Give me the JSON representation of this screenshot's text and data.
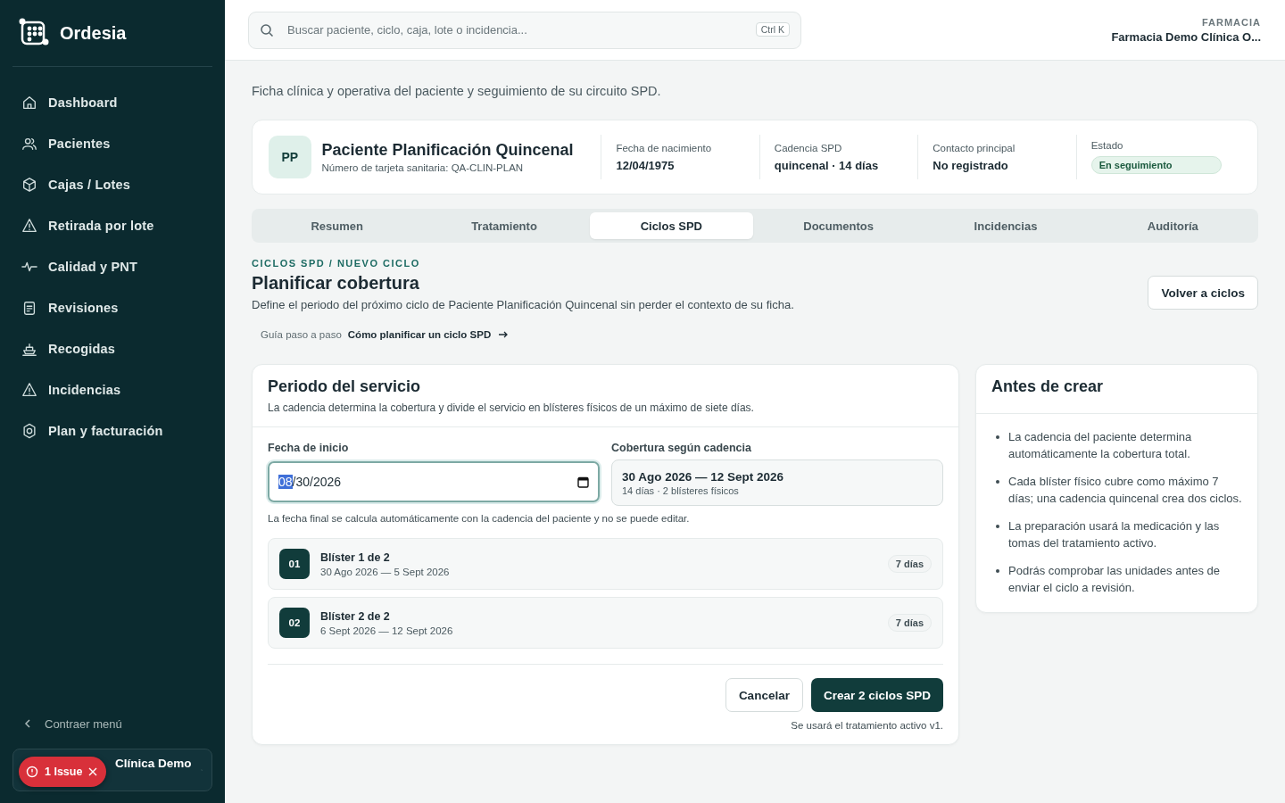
{
  "sidebar": {
    "brand": "Ordesia",
    "items": [
      {
        "label": "Dashboard"
      },
      {
        "label": "Pacientes"
      },
      {
        "label": "Cajas / Lotes"
      },
      {
        "label": "Retirada por lote"
      },
      {
        "label": "Calidad y PNT"
      },
      {
        "label": "Revisiones"
      },
      {
        "label": "Recogidas"
      },
      {
        "label": "Incidencias"
      },
      {
        "label": "Plan y facturación"
      }
    ],
    "collapse": "Contraer menú",
    "account": "Clínica Demo",
    "issue_badge": "1 Issue"
  },
  "header": {
    "search": {
      "placeholder": "Buscar paciente, ciclo, caja, lote o incidencia...",
      "shortcut": "Ctrl K"
    },
    "org_label": "FARMACIA",
    "org_name": "Farmacia Demo Clínica O..."
  },
  "page": {
    "subtitle": "Ficha clínica y operativa del paciente y seguimiento de su circuito SPD."
  },
  "patient": {
    "initials": "PP",
    "name": "Paciente Planificación Quincenal",
    "card": "Número de tarjeta sanitaria: QA-CLIN-PLAN",
    "facts": [
      {
        "label": "Fecha de nacimiento",
        "value": "12/04/1975"
      },
      {
        "label": "Cadencia SPD",
        "value": "quincenal · 14 días"
      },
      {
        "label": "Contacto principal",
        "value": "No registrado"
      }
    ],
    "status_label": "Estado",
    "status": "En seguimiento"
  },
  "tabs": [
    {
      "label": "Resumen",
      "selected": false
    },
    {
      "label": "Tratamiento",
      "selected": false
    },
    {
      "label": "Ciclos SPD",
      "selected": true
    },
    {
      "label": "Documentos",
      "selected": false
    },
    {
      "label": "Incidencias",
      "selected": false
    },
    {
      "label": "Auditoría",
      "selected": false
    }
  ],
  "section": {
    "breadcrumb": "CICLOS SPD / NUEVO CICLO",
    "title": "Planificar cobertura",
    "description": "Define el periodo del próximo ciclo de Paciente Planificación Quincenal sin perder el contexto de su ficha.",
    "back_button": "Volver a ciclos",
    "guide_label": "Guía paso a paso",
    "guide_link": "Cómo planificar un ciclo SPD"
  },
  "period_card": {
    "title": "Periodo del servicio",
    "description": "La cadencia determina la cobertura y divide el servicio en blísteres físicos de un máximo de siete días.",
    "start_label": "Fecha de inicio",
    "start_value_parts": [
      "08",
      "/30/2026"
    ],
    "coverage_label": "Cobertura según cadencia",
    "coverage_range": "30 Ago 2026 — 12 Sept 2026",
    "coverage_detail": "14 días · 2 blísteres físicos",
    "hint": "La fecha final se calcula automáticamente con la cadencia del paciente y no se puede editar.",
    "blisters": [
      {
        "number": "01",
        "title": "Blíster 1 de 2",
        "range": "30 Ago 2026 — 5 Sept 2026",
        "days": "7 días"
      },
      {
        "number": "02",
        "title": "Blíster 2 de 2",
        "range": "6 Sept 2026 — 12 Sept 2026",
        "days": "7 días"
      }
    ],
    "cancel": "Cancelar",
    "submit": "Crear 2 ciclos SPD",
    "footnote": "Se usará el tratamiento activo v1."
  },
  "notes_card": {
    "title": "Antes de crear",
    "items": [
      "La cadencia del paciente determina automáticamente la cobertura total.",
      "Cada blíster físico cubre como máximo 7 días; una cadencia quincenal crea dos ciclos.",
      "La preparación usará la medicación y las tomas del tratamiento activo.",
      "Podrás comprobar las unidades antes de enviar el ciclo a revisión."
    ]
  }
}
